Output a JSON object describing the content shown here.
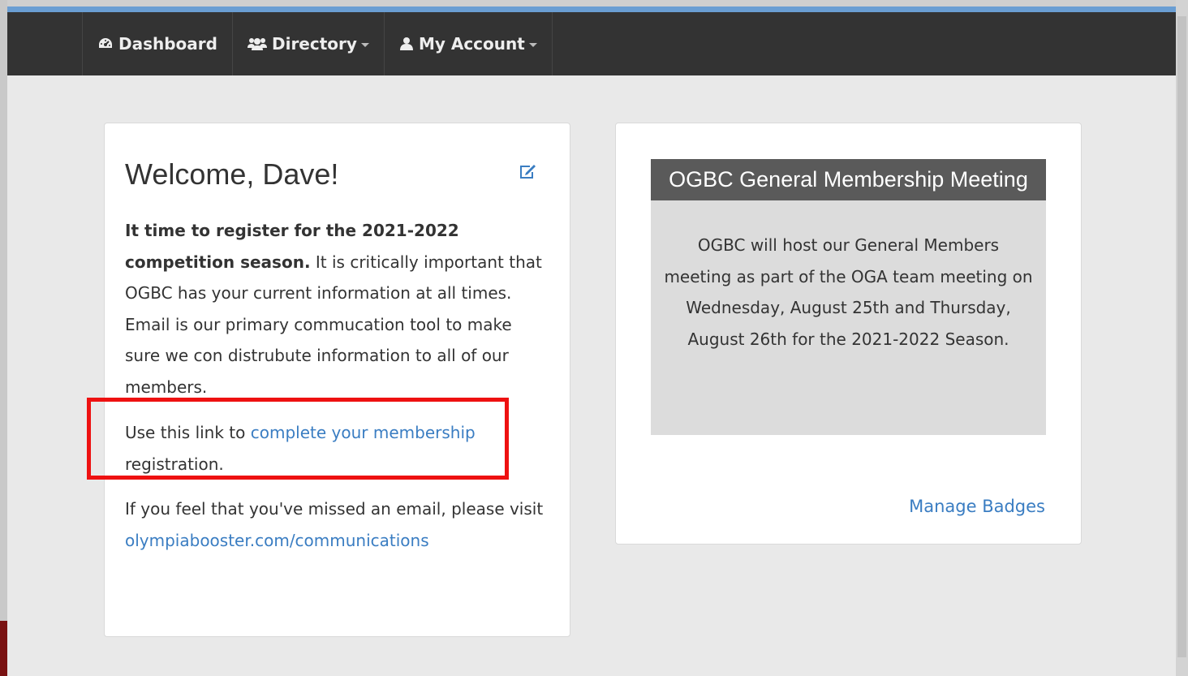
{
  "nav": {
    "items": [
      {
        "label": "Dashboard",
        "icon": "dashboard-icon",
        "has_dropdown": false
      },
      {
        "label": "Directory",
        "icon": "users-icon",
        "has_dropdown": true
      },
      {
        "label": "My Account",
        "icon": "user-icon",
        "has_dropdown": true
      }
    ]
  },
  "welcome_card": {
    "title": "Welcome, Dave!",
    "p1_bold": "It time to register for the 2021-2022 competition season.",
    "p1_text": "  It is critically important that OGBC has your current information at all times.  Email is our primary commucation tool to make sure we con distrubute information to all of our members.",
    "p2_prefix": "Use this link to ",
    "p2_link": "complete your membership",
    "p2_suffix": " registration.",
    "p3_prefix": "If you feel that you've missed an email, please visit ",
    "p3_link": "olympiabooster.com/communications"
  },
  "meeting_card": {
    "title": "OGBC General Membership Meeting",
    "body": "OGBC will host our General Members meeting as part of the OGA team meeting on Wednesday, August 25th and Thursday, August 26th for the 2021-2022 Season.",
    "manage_badges_label": "Manage Badges"
  },
  "colors": {
    "navbar": "#333333",
    "top_stripe": "#6a9ed3",
    "link": "#3a7dc2",
    "highlight": "#ee1111",
    "meeting_header": "#5a5a5a"
  }
}
